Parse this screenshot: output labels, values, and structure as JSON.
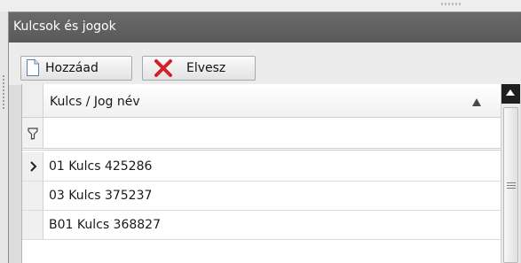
{
  "panel": {
    "title": "Kulcsok és jogok"
  },
  "toolbar": {
    "add_label": "Hozzáad",
    "remove_label": "Elvesz",
    "add_icon": "document-icon",
    "remove_icon": "red-x-icon",
    "remove_icon_color": "#d4202a"
  },
  "grid": {
    "column_header": "Kulcs / Jog név",
    "sort_direction": "ascending",
    "filter_value": "",
    "rows": [
      {
        "name": "01 Kulcs 425286",
        "current": true
      },
      {
        "name": "03 Kulcs 375237",
        "current": false
      },
      {
        "name": "B01 Kulcs 368827",
        "current": false
      }
    ]
  },
  "colors": {
    "title_bar": "#5f5f5f",
    "title_text": "#ffffff",
    "toolbar_bg": "#ececec"
  }
}
